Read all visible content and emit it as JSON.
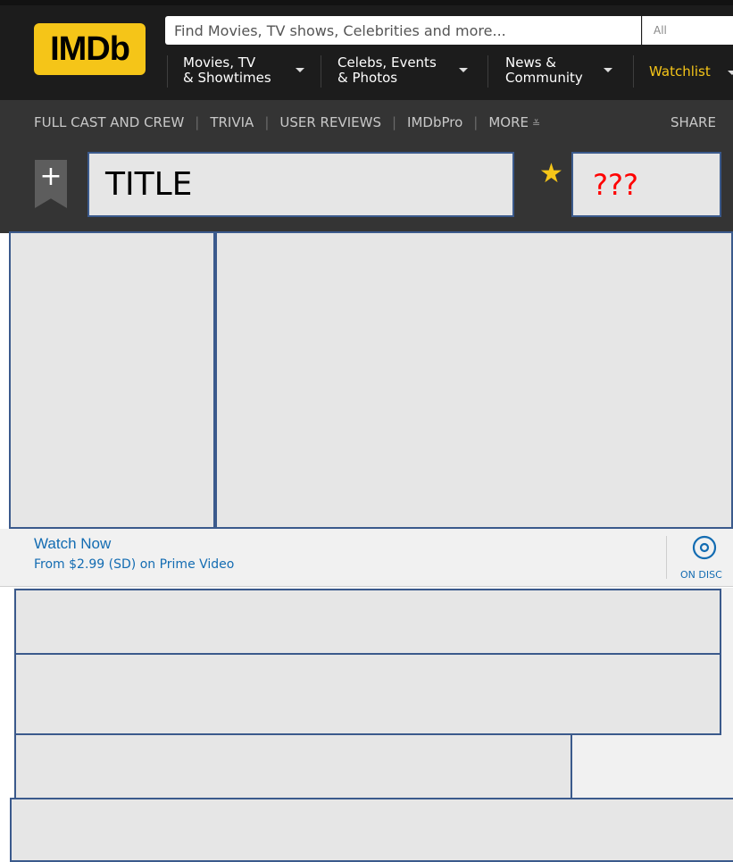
{
  "header": {
    "logo_text": "IMDb",
    "search": {
      "placeholder": "Find Movies, TV shows, Celebrities and more...",
      "category": "All"
    },
    "nav": [
      {
        "line1": "Movies, TV",
        "line2": "& Showtimes"
      },
      {
        "line1": "Celebs, Events",
        "line2": "& Photos"
      },
      {
        "line1": "News &",
        "line2": "Community"
      }
    ],
    "watchlist_label": "Watchlist"
  },
  "subnav": {
    "links": [
      "FULL CAST AND CREW",
      "TRIVIA",
      "USER REVIEWS",
      "IMDbPro",
      "MORE"
    ],
    "share_label": "SHARE"
  },
  "title_block": {
    "add_symbol": "+",
    "title": "TITLE",
    "star_symbol": "★",
    "rating": "???"
  },
  "watch": {
    "title": "Watch Now",
    "subtitle": "From $2.99 (SD) on Prime Video",
    "disc_label": "ON DISC"
  },
  "colors": {
    "brand": "#f5c518",
    "link": "#136cb2",
    "placeholder_border": "#3b5a8c",
    "rating": "#ff0000"
  }
}
